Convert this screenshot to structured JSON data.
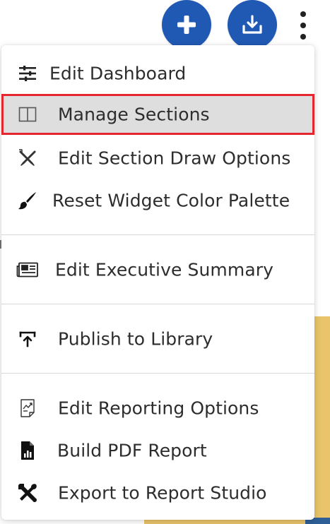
{
  "toolbar": {
    "add_button_icon": "plus-icon",
    "download_button_icon": "download-icon",
    "more_button_icon": "kebab-icon",
    "accent_color": "#2059b3"
  },
  "menu": {
    "sections": [
      {
        "items": [
          {
            "label": "Edit Dashboard",
            "icon": "sliders-icon"
          },
          {
            "label": "Manage Sections",
            "icon": "columns-icon",
            "highlighted": true
          },
          {
            "label": "Edit Section Draw Options",
            "icon": "pencil-cross-icon"
          },
          {
            "label": "Reset Widget Color Palette",
            "icon": "paintbrush-icon"
          }
        ]
      },
      {
        "items": [
          {
            "label": "Edit Executive Summary",
            "icon": "newspaper-icon"
          }
        ]
      },
      {
        "items": [
          {
            "label": "Publish to Library",
            "icon": "publish-icon"
          }
        ]
      },
      {
        "items": [
          {
            "label": "Edit Reporting Options",
            "icon": "report-chart-icon"
          },
          {
            "label": "Build PDF Report",
            "icon": "pdf-chart-icon"
          },
          {
            "label": "Export to Report Studio",
            "icon": "tools-icon"
          }
        ]
      }
    ],
    "highlight_color": "#e5252f"
  }
}
